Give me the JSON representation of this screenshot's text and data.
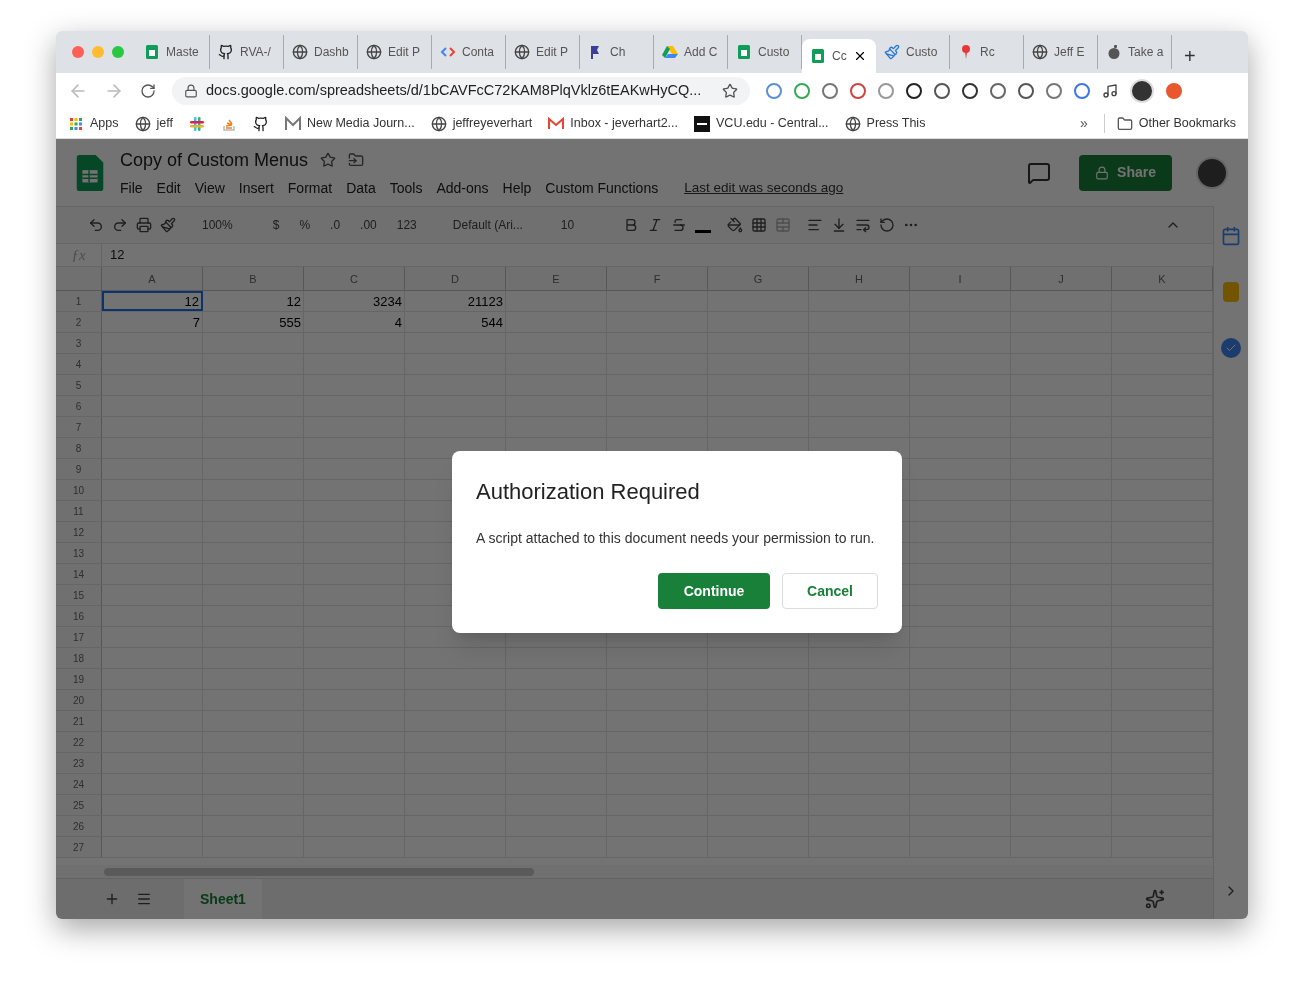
{
  "browser": {
    "tabs": [
      {
        "title": "Maste",
        "kind": "sheets",
        "selected": false
      },
      {
        "title": "RVA-/",
        "kind": "github",
        "selected": false
      },
      {
        "title": "Dashb",
        "kind": "globe",
        "selected": false
      },
      {
        "title": "Edit P",
        "kind": "globe",
        "selected": false
      },
      {
        "title": "Conta",
        "kind": "code",
        "selected": false
      },
      {
        "title": "Edit P",
        "kind": "globe",
        "selected": false
      },
      {
        "title": "Ch",
        "kind": "flag",
        "selected": false
      },
      {
        "title": "Add C",
        "kind": "drive",
        "selected": false
      },
      {
        "title": "Custo",
        "kind": "sheets",
        "selected": false
      },
      {
        "title": "Cc",
        "kind": "sheets",
        "selected": true
      },
      {
        "title": "Custo",
        "kind": "brush",
        "selected": false
      },
      {
        "title": "Rc",
        "kind": "pin",
        "selected": false
      },
      {
        "title": "Jeff E",
        "kind": "globe",
        "selected": false
      },
      {
        "title": "Take a",
        "kind": "apple",
        "selected": false
      }
    ],
    "new_tab": "+",
    "url": "docs.google.com/spreadsheets/d/1bCAVFcC72KAM8PlqVklz6tEAKwHyCQ...",
    "bookmarks": [
      {
        "label": "Apps",
        "kind": "grid"
      },
      {
        "label": "jeff",
        "kind": "globe"
      },
      {
        "kind": "slack"
      },
      {
        "kind": "stack"
      },
      {
        "kind": "github"
      },
      {
        "label": "New Media Journ...",
        "kind": "m"
      },
      {
        "label": "jeffreyeverhart",
        "kind": "globe"
      },
      {
        "label": "Inbox - jeverhart2...",
        "kind": "gmail"
      },
      {
        "label": "VCU.edu - Central...",
        "kind": "vcu"
      },
      {
        "label": "Press This",
        "kind": "globe"
      }
    ],
    "more": "»",
    "other_bookmarks": "Other Bookmarks"
  },
  "sheet": {
    "title": "Copy of Custom Menus",
    "menu": [
      "File",
      "Edit",
      "View",
      "Insert",
      "Format",
      "Data",
      "Tools",
      "Add-ons",
      "Help",
      "Custom Functions"
    ],
    "last_edit": "Last edit was seconds ago",
    "share": "Share",
    "toolbar": {
      "zoom": "100%",
      "currency": "$",
      "percent": "%",
      "dec_less": ".0",
      "dec_more": ".00",
      "format": "123",
      "font": "Default (Ari...",
      "size": "10"
    },
    "fx": "ƒx",
    "formula": "12",
    "columns": [
      "A",
      "B",
      "C",
      "D",
      "E",
      "F",
      "G",
      "H",
      "I",
      "J",
      "K"
    ],
    "rows": [
      {
        "label": "1",
        "cells": [
          {
            "value": "12",
            "selected": true
          },
          {
            "value": "12",
            "selected": false
          },
          {
            "value": "3234",
            "selected": false
          },
          {
            "value": "21123",
            "selected": false
          }
        ]
      },
      {
        "label": "2",
        "cells": [
          {
            "value": "7",
            "selected": false
          },
          {
            "value": "555",
            "selected": false
          },
          {
            "value": "4",
            "selected": false
          },
          {
            "value": "544",
            "selected": false
          }
        ]
      },
      {
        "label": "3"
      },
      {
        "label": "4"
      },
      {
        "label": "5"
      },
      {
        "label": "6"
      },
      {
        "label": "7"
      },
      {
        "label": "8"
      },
      {
        "label": "9"
      },
      {
        "label": "10"
      },
      {
        "label": "11"
      },
      {
        "label": "12"
      },
      {
        "label": "13"
      },
      {
        "label": "14"
      },
      {
        "label": "15"
      },
      {
        "label": "16"
      },
      {
        "label": "17"
      },
      {
        "label": "18"
      },
      {
        "label": "19"
      },
      {
        "label": "20"
      },
      {
        "label": "21"
      },
      {
        "label": "22"
      },
      {
        "label": "23"
      },
      {
        "label": "24"
      },
      {
        "label": "25"
      },
      {
        "label": "26"
      },
      {
        "label": "27"
      }
    ],
    "sheet_tabs": [
      {
        "label": "Sheet1",
        "selected": true
      }
    ]
  },
  "dialog": {
    "title": "Authorization Required",
    "message": "A script attached to this document needs your permission to run.",
    "buttons": [
      {
        "label": "Continue",
        "kind": "primary"
      },
      {
        "label": "Cancel",
        "kind": "secondary"
      }
    ]
  }
}
